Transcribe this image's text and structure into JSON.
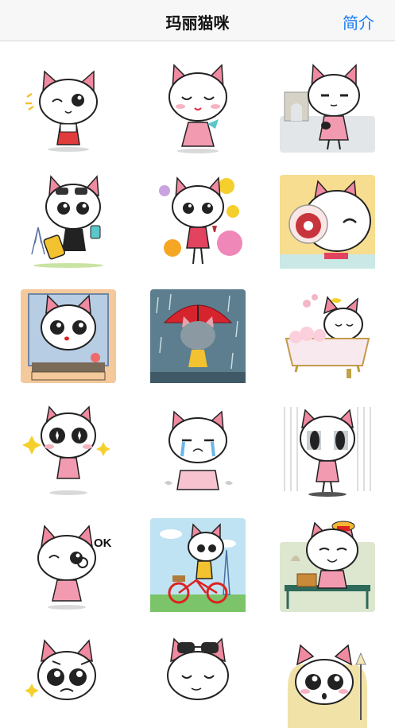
{
  "header": {
    "title": "玛丽猫咪",
    "action_label": "简介"
  },
  "colors": {
    "accent": "#1a7cf5",
    "cat_ear": "#f08aa0",
    "dress": "#f29ab0"
  },
  "stickers": [
    {
      "name": "sticker-wink-pose",
      "icon": "cat-wink"
    },
    {
      "name": "sticker-blush-kiss",
      "icon": "cat-blush"
    },
    {
      "name": "sticker-paris-arc",
      "icon": "cat-paris"
    },
    {
      "name": "sticker-travel-suitcase",
      "icon": "cat-travel"
    },
    {
      "name": "sticker-party-wine",
      "icon": "cat-party"
    },
    {
      "name": "sticker-wine-glass",
      "icon": "cat-wine"
    },
    {
      "name": "sticker-window",
      "icon": "cat-window"
    },
    {
      "name": "sticker-rain-umbrella",
      "icon": "cat-umbrella"
    },
    {
      "name": "sticker-bubble-bath",
      "icon": "cat-bath"
    },
    {
      "name": "sticker-sparkle-eyes",
      "icon": "cat-sparkle"
    },
    {
      "name": "sticker-crying",
      "icon": "cat-cry"
    },
    {
      "name": "sticker-shock",
      "icon": "cat-shock"
    },
    {
      "name": "sticker-ok",
      "icon": "cat-ok",
      "text": "OK"
    },
    {
      "name": "sticker-bicycle",
      "icon": "cat-bike"
    },
    {
      "name": "sticker-picnic",
      "icon": "cat-picnic"
    },
    {
      "name": "sticker-sad",
      "icon": "cat-sad"
    },
    {
      "name": "sticker-sunglasses",
      "icon": "cat-sunglasses"
    },
    {
      "name": "sticker-armchair",
      "icon": "cat-armchair"
    }
  ]
}
